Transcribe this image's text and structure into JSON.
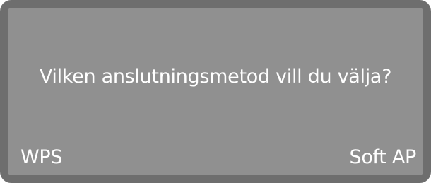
{
  "display": {
    "prompt": "Vilken anslutningsmetod vill du välja?",
    "left_option": "WPS",
    "right_option": "Soft AP"
  },
  "colors": {
    "bezel": "#6e6e6e",
    "screen": "#909090",
    "text": "#ffffff"
  }
}
